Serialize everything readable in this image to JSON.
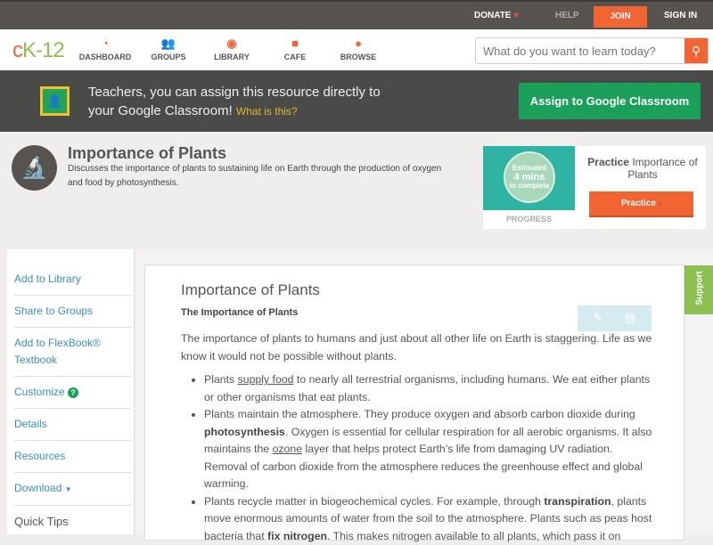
{
  "topbar": {
    "donate": "DONATE",
    "help": "HELP",
    "join": "JOIN",
    "signin": "SIGN IN"
  },
  "nav": {
    "logo": "cK-12",
    "items": [
      "DASHBOARD",
      "GROUPS",
      "LIBRARY",
      "CAFE",
      "BROWSE"
    ],
    "search_placeholder": "What do you want to learn today?"
  },
  "banner": {
    "line1": "Teachers, you can assign this resource directly to",
    "line2": "your Google Classroom!",
    "link": "What is this?",
    "button": "Assign to Google Classroom"
  },
  "header": {
    "title": "Importance of Plants",
    "description": "Discusses the importance of plants to sustaining life on Earth through the production of oxygen and food by photosynthesis."
  },
  "practice": {
    "est1": "Estimated",
    "est2": "4 mins",
    "est3": "to complete",
    "progress": "PROGRESS",
    "label_bold": "Practice",
    "label": "Importance of Plants",
    "button": "Practice"
  },
  "sidebar": {
    "items": [
      "Add to Library",
      "Share to Groups",
      "Add to FlexBook® Textbook",
      "Customize",
      "Details",
      "Resources",
      "Download",
      "Quick Tips"
    ]
  },
  "content": {
    "title": "Importance of Plants",
    "subtitle": "The Importance of Plants",
    "intro": "The importance of plants to humans and just about all other life on Earth is staggering. Life as we know it would not be possible without plants.",
    "b1": [
      "Plants ",
      "supply food",
      " to nearly all terrestrial organisms, including humans. We eat either plants or other organisms that eat plants."
    ],
    "b2": [
      "Plants maintain the atmosphere. They produce oxygen and absorb carbon dioxide during ",
      "photosynthesis",
      ". Oxygen is essential for cellular respiration for all aerobic organisms. It also maintains the ",
      "ozone",
      " layer that helps protect Earth’s life from damaging UV radiation. Removal of carbon dioxide from the atmosphere reduces the greenhouse effect and global warming."
    ],
    "b3": [
      "Plants recycle matter in biogeochemical cycles. For example, through ",
      "transpiration",
      ", plants move enormous amounts of water from the soil to the atmosphere. Plants such as peas host bacteria that ",
      "fix nitrogen",
      ". This makes nitrogen available to all plants, which pass it on"
    ]
  },
  "support": "Support",
  "colors": {
    "accent": "#f26431",
    "green": "#1aa05a",
    "dark": "#57534e"
  }
}
